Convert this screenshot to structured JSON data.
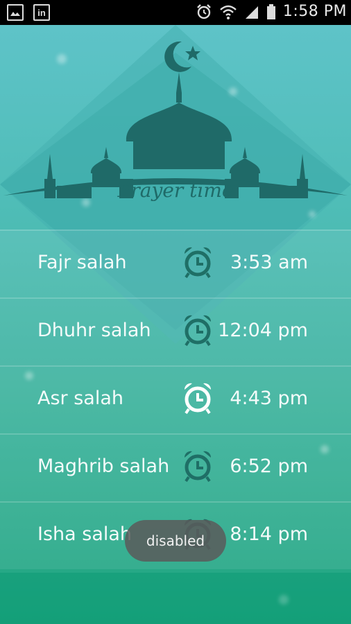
{
  "status_bar": {
    "time": "1:58 PM",
    "left_icons": [
      "image-icon",
      "linkedin-icon"
    ],
    "right_icons": [
      "alarm-icon",
      "wifi-icon",
      "signal-icon",
      "battery-icon"
    ],
    "linkedin_text": "in"
  },
  "header": {
    "title": "Prayer time"
  },
  "prayers": [
    {
      "name": "Fajr salah",
      "time": "3:53 am",
      "alarm_enabled": true
    },
    {
      "name": "Dhuhr salah",
      "time": "12:04 pm",
      "alarm_enabled": true
    },
    {
      "name": "Asr salah",
      "time": "4:43 pm",
      "alarm_enabled": false
    },
    {
      "name": "Maghrib salah",
      "time": "6:52 pm",
      "alarm_enabled": true
    },
    {
      "name": "Isha salah",
      "time": "8:14 pm",
      "alarm_enabled": true
    }
  ],
  "toast": {
    "text": "disabled"
  },
  "colors": {
    "alarm_active": "#1f6f66",
    "alarm_inactive": "#ffffff",
    "silhouette": "#1f6a68"
  }
}
